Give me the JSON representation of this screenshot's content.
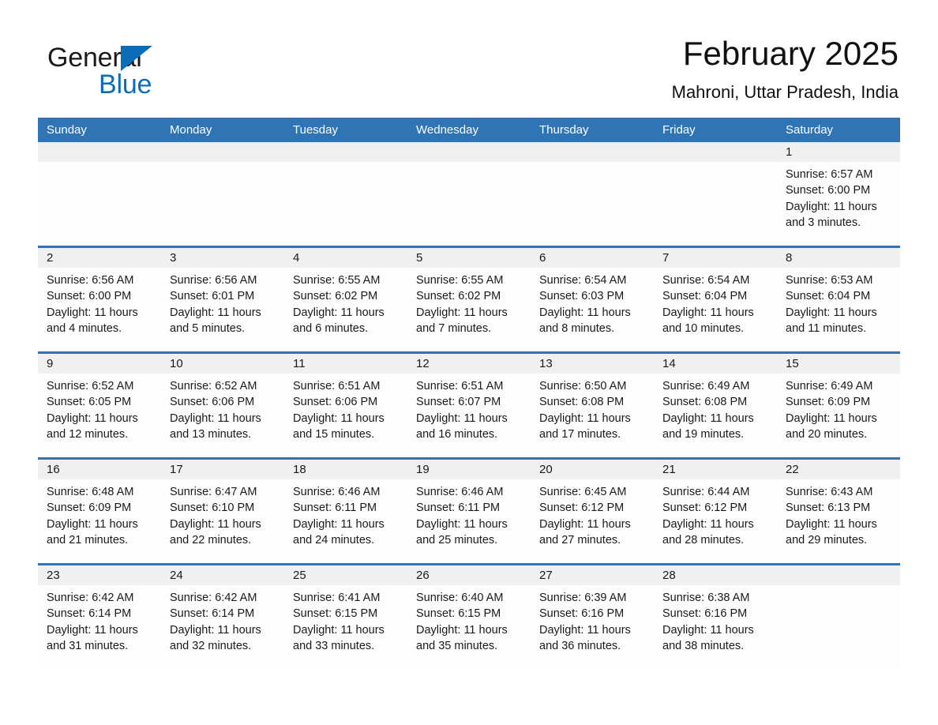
{
  "brand": {
    "name_part1": "General",
    "name_part2": "Blue",
    "triangle_color": "#0b6cb8"
  },
  "header": {
    "title": "February 2025",
    "location": "Mahroni, Uttar Pradesh, India"
  },
  "theme": {
    "header_blue": "#2f74b5",
    "daynum_band": "#f0f0f0",
    "cell_background": "#fdfdfe",
    "text_color": "#1a1a1a"
  },
  "calendar": {
    "weekdays": [
      "Sunday",
      "Monday",
      "Tuesday",
      "Wednesday",
      "Thursday",
      "Friday",
      "Saturday"
    ],
    "weeks": [
      [
        {
          "day": "",
          "empty": true
        },
        {
          "day": "",
          "empty": true
        },
        {
          "day": "",
          "empty": true
        },
        {
          "day": "",
          "empty": true
        },
        {
          "day": "",
          "empty": true
        },
        {
          "day": "",
          "empty": true
        },
        {
          "day": "1",
          "sunrise": "Sunrise: 6:57 AM",
          "sunset": "Sunset: 6:00 PM",
          "daylight": "Daylight: 11 hours and 3 minutes."
        }
      ],
      [
        {
          "day": "2",
          "sunrise": "Sunrise: 6:56 AM",
          "sunset": "Sunset: 6:00 PM",
          "daylight": "Daylight: 11 hours and 4 minutes."
        },
        {
          "day": "3",
          "sunrise": "Sunrise: 6:56 AM",
          "sunset": "Sunset: 6:01 PM",
          "daylight": "Daylight: 11 hours and 5 minutes."
        },
        {
          "day": "4",
          "sunrise": "Sunrise: 6:55 AM",
          "sunset": "Sunset: 6:02 PM",
          "daylight": "Daylight: 11 hours and 6 minutes."
        },
        {
          "day": "5",
          "sunrise": "Sunrise: 6:55 AM",
          "sunset": "Sunset: 6:02 PM",
          "daylight": "Daylight: 11 hours and 7 minutes."
        },
        {
          "day": "6",
          "sunrise": "Sunrise: 6:54 AM",
          "sunset": "Sunset: 6:03 PM",
          "daylight": "Daylight: 11 hours and 8 minutes."
        },
        {
          "day": "7",
          "sunrise": "Sunrise: 6:54 AM",
          "sunset": "Sunset: 6:04 PM",
          "daylight": "Daylight: 11 hours and 10 minutes."
        },
        {
          "day": "8",
          "sunrise": "Sunrise: 6:53 AM",
          "sunset": "Sunset: 6:04 PM",
          "daylight": "Daylight: 11 hours and 11 minutes."
        }
      ],
      [
        {
          "day": "9",
          "sunrise": "Sunrise: 6:52 AM",
          "sunset": "Sunset: 6:05 PM",
          "daylight": "Daylight: 11 hours and 12 minutes."
        },
        {
          "day": "10",
          "sunrise": "Sunrise: 6:52 AM",
          "sunset": "Sunset: 6:06 PM",
          "daylight": "Daylight: 11 hours and 13 minutes."
        },
        {
          "day": "11",
          "sunrise": "Sunrise: 6:51 AM",
          "sunset": "Sunset: 6:06 PM",
          "daylight": "Daylight: 11 hours and 15 minutes."
        },
        {
          "day": "12",
          "sunrise": "Sunrise: 6:51 AM",
          "sunset": "Sunset: 6:07 PM",
          "daylight": "Daylight: 11 hours and 16 minutes."
        },
        {
          "day": "13",
          "sunrise": "Sunrise: 6:50 AM",
          "sunset": "Sunset: 6:08 PM",
          "daylight": "Daylight: 11 hours and 17 minutes."
        },
        {
          "day": "14",
          "sunrise": "Sunrise: 6:49 AM",
          "sunset": "Sunset: 6:08 PM",
          "daylight": "Daylight: 11 hours and 19 minutes."
        },
        {
          "day": "15",
          "sunrise": "Sunrise: 6:49 AM",
          "sunset": "Sunset: 6:09 PM",
          "daylight": "Daylight: 11 hours and 20 minutes."
        }
      ],
      [
        {
          "day": "16",
          "sunrise": "Sunrise: 6:48 AM",
          "sunset": "Sunset: 6:09 PM",
          "daylight": "Daylight: 11 hours and 21 minutes."
        },
        {
          "day": "17",
          "sunrise": "Sunrise: 6:47 AM",
          "sunset": "Sunset: 6:10 PM",
          "daylight": "Daylight: 11 hours and 22 minutes."
        },
        {
          "day": "18",
          "sunrise": "Sunrise: 6:46 AM",
          "sunset": "Sunset: 6:11 PM",
          "daylight": "Daylight: 11 hours and 24 minutes."
        },
        {
          "day": "19",
          "sunrise": "Sunrise: 6:46 AM",
          "sunset": "Sunset: 6:11 PM",
          "daylight": "Daylight: 11 hours and 25 minutes."
        },
        {
          "day": "20",
          "sunrise": "Sunrise: 6:45 AM",
          "sunset": "Sunset: 6:12 PM",
          "daylight": "Daylight: 11 hours and 27 minutes."
        },
        {
          "day": "21",
          "sunrise": "Sunrise: 6:44 AM",
          "sunset": "Sunset: 6:12 PM",
          "daylight": "Daylight: 11 hours and 28 minutes."
        },
        {
          "day": "22",
          "sunrise": "Sunrise: 6:43 AM",
          "sunset": "Sunset: 6:13 PM",
          "daylight": "Daylight: 11 hours and 29 minutes."
        }
      ],
      [
        {
          "day": "23",
          "sunrise": "Sunrise: 6:42 AM",
          "sunset": "Sunset: 6:14 PM",
          "daylight": "Daylight: 11 hours and 31 minutes."
        },
        {
          "day": "24",
          "sunrise": "Sunrise: 6:42 AM",
          "sunset": "Sunset: 6:14 PM",
          "daylight": "Daylight: 11 hours and 32 minutes."
        },
        {
          "day": "25",
          "sunrise": "Sunrise: 6:41 AM",
          "sunset": "Sunset: 6:15 PM",
          "daylight": "Daylight: 11 hours and 33 minutes."
        },
        {
          "day": "26",
          "sunrise": "Sunrise: 6:40 AM",
          "sunset": "Sunset: 6:15 PM",
          "daylight": "Daylight: 11 hours and 35 minutes."
        },
        {
          "day": "27",
          "sunrise": "Sunrise: 6:39 AM",
          "sunset": "Sunset: 6:16 PM",
          "daylight": "Daylight: 11 hours and 36 minutes."
        },
        {
          "day": "28",
          "sunrise": "Sunrise: 6:38 AM",
          "sunset": "Sunset: 6:16 PM",
          "daylight": "Daylight: 11 hours and 38 minutes."
        },
        {
          "day": "",
          "empty": true
        }
      ]
    ]
  }
}
